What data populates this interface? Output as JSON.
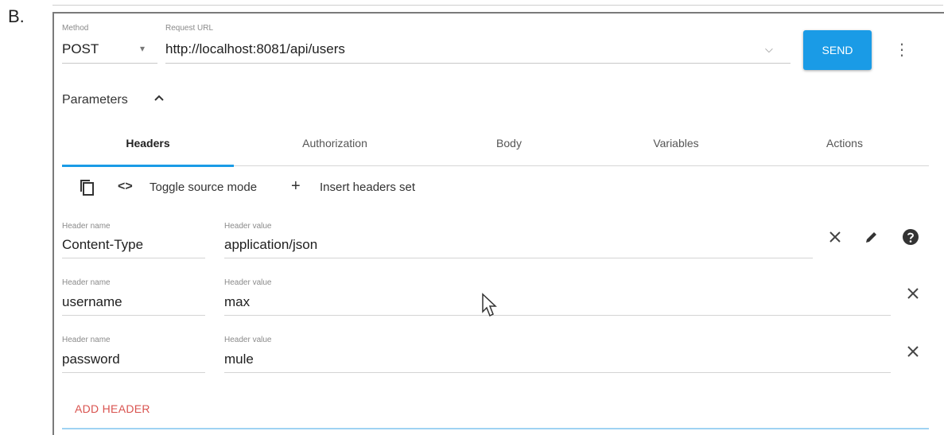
{
  "option_label": "B.",
  "request": {
    "method_label": "Method",
    "method_value": "POST",
    "url_label": "Request URL",
    "url_value": "http://localhost:8081/api/users",
    "send_label": "SEND"
  },
  "parameters": {
    "label": "Parameters"
  },
  "tabs": [
    {
      "label": "Headers",
      "active": true
    },
    {
      "label": "Authorization",
      "active": false
    },
    {
      "label": "Body",
      "active": false
    },
    {
      "label": "Variables",
      "active": false
    },
    {
      "label": "Actions",
      "active": false
    }
  ],
  "toolbar": {
    "toggle_source": "Toggle source mode",
    "insert_headers": "Insert headers set"
  },
  "headers": [
    {
      "name_label": "Header name",
      "name": "Content-Type",
      "value_label": "Header value",
      "value": "application/json"
    },
    {
      "name_label": "Header name",
      "name": "username",
      "value_label": "Header value",
      "value": "max"
    },
    {
      "name_label": "Header name",
      "name": "password",
      "value_label": "Header value",
      "value": "mule"
    }
  ],
  "add_header_label": "ADD HEADER",
  "colors": {
    "accent": "#1a9be6",
    "add_header": "#d9534f"
  }
}
